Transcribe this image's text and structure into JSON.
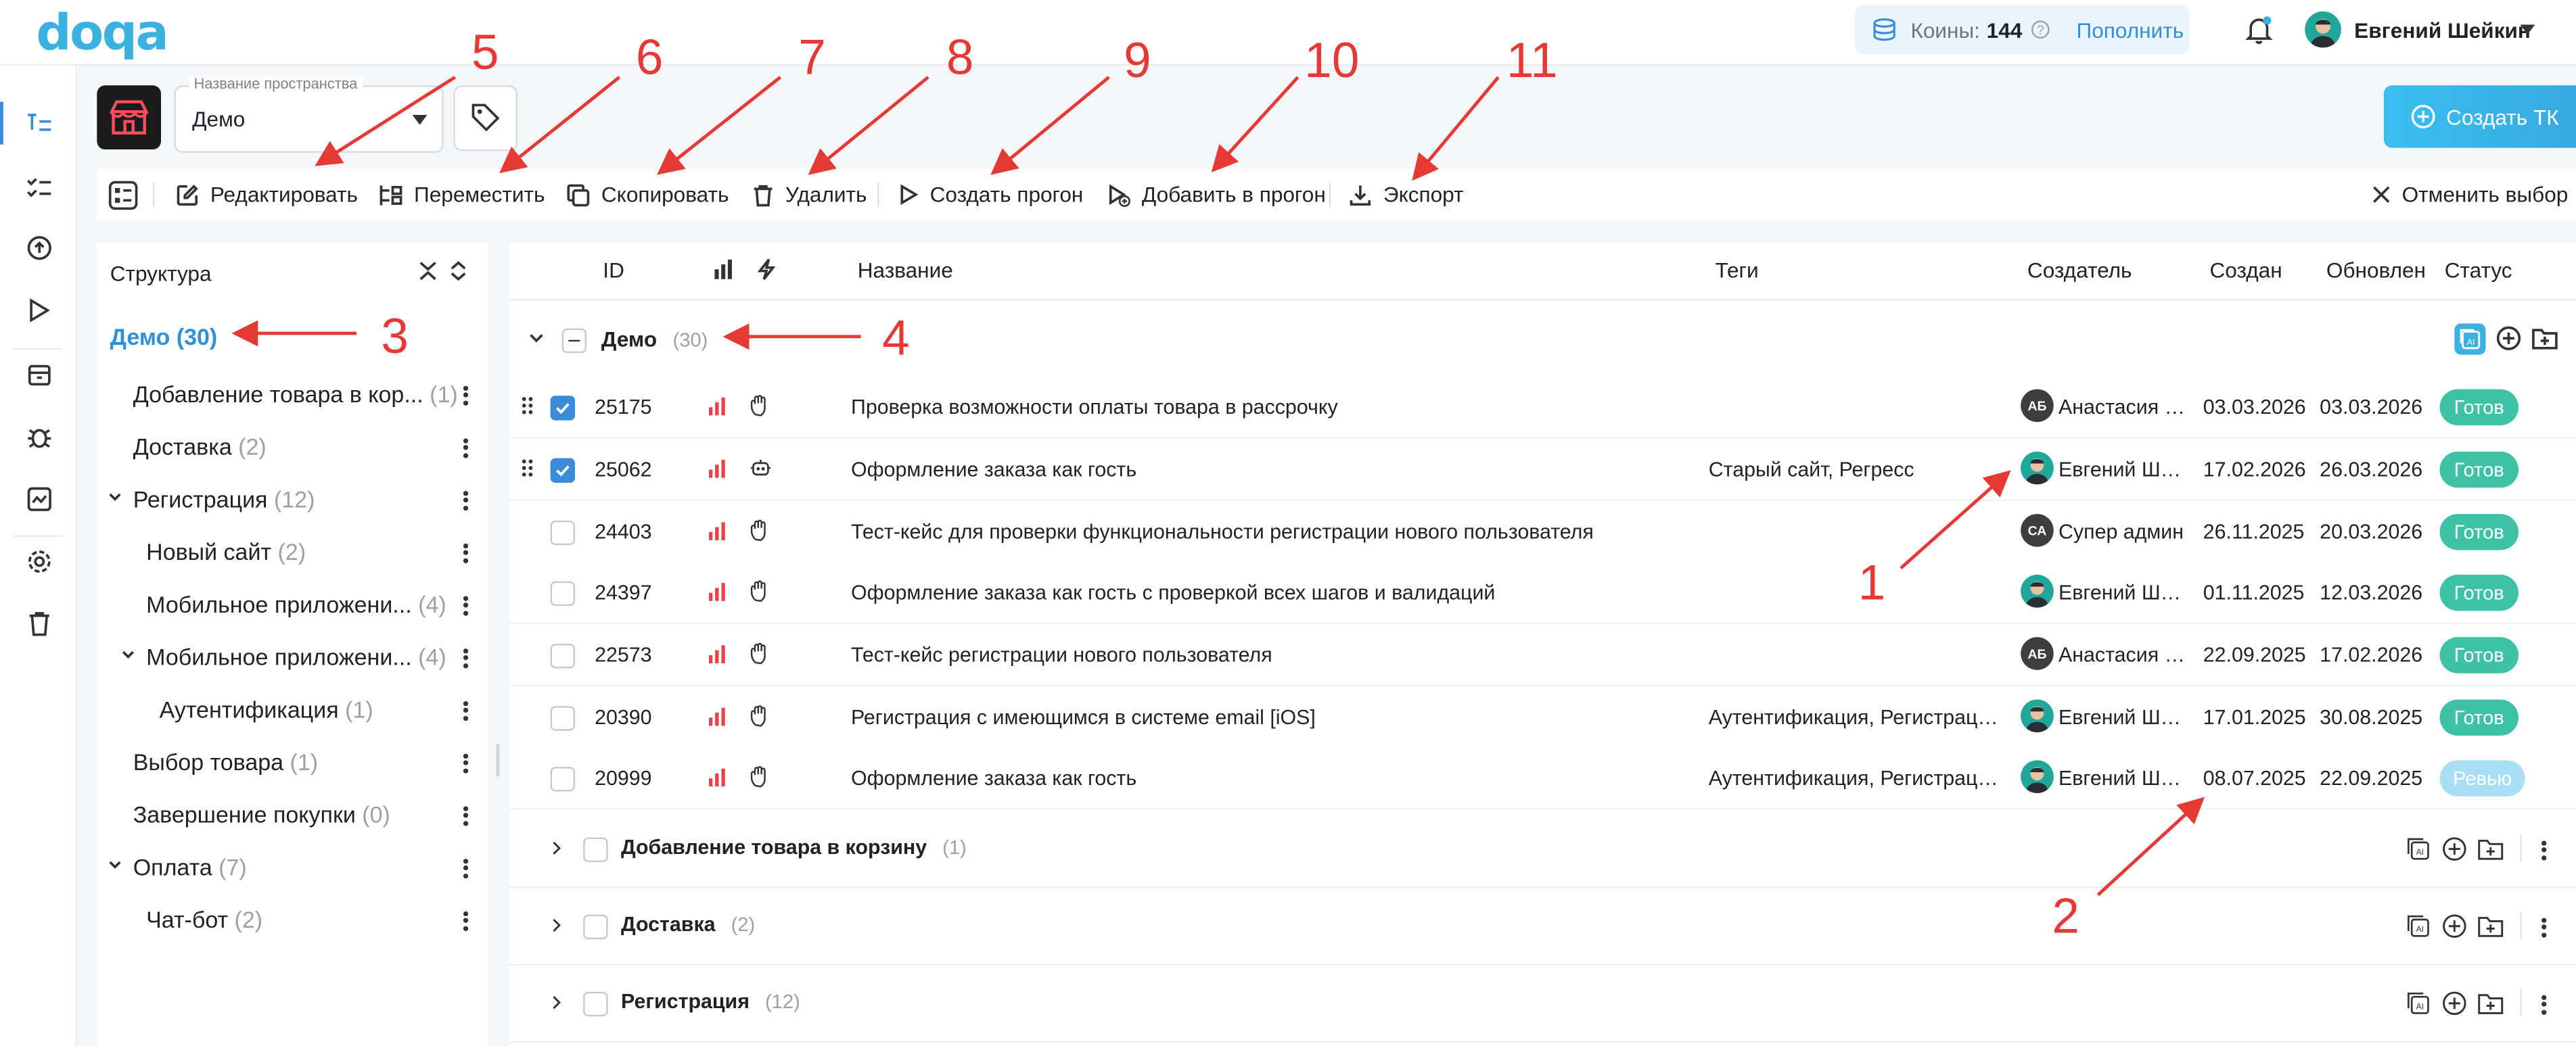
{
  "app": {
    "logo": "doqa"
  },
  "header": {
    "coins_label": "Коины:",
    "coins_value": "144",
    "topup_label": "Пополнить",
    "user_name": "Евгений Шейкин"
  },
  "workspace": {
    "field_label": "Название пространства",
    "value": "Демо",
    "create_button": "Создать ТК"
  },
  "actions": {
    "edit": "Редактировать",
    "move": "Переместить",
    "copy": "Скопировать",
    "delete": "Удалить",
    "create_run": "Создать прогон",
    "add_to_run": "Добавить в прогон",
    "export": "Экспорт",
    "cancel_selection": "Отменить выбор"
  },
  "structure": {
    "title": "Структура",
    "root": {
      "label": "Демо",
      "count": "(30)"
    },
    "items": [
      {
        "label": "Добавление товара в кор...",
        "count": "(1)"
      },
      {
        "label": "Доставка",
        "count": "(2)"
      },
      {
        "label": "Регистрация",
        "count": "(12)"
      },
      {
        "label": "Новый сайт",
        "count": "(2)"
      },
      {
        "label": "Мобильное приложени...",
        "count": "(4)"
      },
      {
        "label": "Мобильное приложени...",
        "count": "(4)"
      },
      {
        "label": "Аутентификация",
        "count": "(1)"
      },
      {
        "label": "Выбор товара",
        "count": "(1)"
      },
      {
        "label": "Завершение покупки",
        "count": "(0)"
      },
      {
        "label": "Оплата",
        "count": "(7)"
      },
      {
        "label": "Чат-бот",
        "count": "(2)"
      }
    ]
  },
  "table": {
    "columns": {
      "id": "ID",
      "name": "Название",
      "tags": "Теги",
      "creator": "Создатель",
      "created": "Создан",
      "updated": "Обновлен",
      "status": "Статус"
    },
    "group": {
      "label": "Демо",
      "count": "(30)"
    },
    "rows": [
      {
        "id": "25175",
        "name": "Проверка возможности оплаты товара в рассрочку",
        "tags": "",
        "avatar": "АБ",
        "creator": "Анастасия Б...",
        "created": "03.03.2026",
        "updated": "03.03.2026",
        "status": "Готов"
      },
      {
        "id": "25062",
        "name": "Оформление заказа как гость",
        "tags": "Старый сайт, Регресс",
        "avatar": "",
        "creator": "Евгений Шей...",
        "created": "17.02.2026",
        "updated": "26.03.2026",
        "status": "Готов"
      },
      {
        "id": "24403",
        "name": "Тест-кейс для проверки функциональности регистрации нового пользователя",
        "tags": "",
        "avatar": "СА",
        "creator": "Супер админ",
        "created": "26.11.2025",
        "updated": "20.03.2026",
        "status": "Готов"
      },
      {
        "id": "24397",
        "name": "Оформление заказа как гость с проверкой всех шагов и валидаций",
        "tags": "",
        "avatar": "",
        "creator": "Евгений Шей...",
        "created": "01.11.2025",
        "updated": "12.03.2026",
        "status": "Готов"
      },
      {
        "id": "22573",
        "name": "Тест-кейс регистрации нового пользователя",
        "tags": "",
        "avatar": "АБ",
        "creator": "Анастасия Б...",
        "created": "22.09.2025",
        "updated": "17.02.2026",
        "status": "Готов"
      },
      {
        "id": "20390",
        "name": "Регистрация с имеющимся в системе email [iOS]",
        "tags": "Аутентификация, Регистрация, ...",
        "avatar": "",
        "creator": "Евгений Шей...",
        "created": "17.01.2025",
        "updated": "30.08.2025",
        "status": "Готов"
      },
      {
        "id": "20999",
        "name": "Оформление заказа как гость",
        "tags": "Аутентификация, Регистрация, ...",
        "avatar": "",
        "creator": "Евгений Шей...",
        "created": "08.07.2025",
        "updated": "22.09.2025",
        "status": "Ревью"
      }
    ],
    "collapsed_groups": [
      {
        "label": "Добавление товара в корзину",
        "count": "(1)"
      },
      {
        "label": "Доставка",
        "count": "(2)"
      },
      {
        "label": "Регистрация",
        "count": "(12)"
      }
    ]
  },
  "annotations": [
    "1",
    "2",
    "3",
    "4",
    "5",
    "6",
    "7",
    "8",
    "9",
    "10",
    "11"
  ],
  "colors": {
    "accent": "#3bb1e0",
    "ready": "#3fc1a5",
    "review": "#a9dff5",
    "annotation": "#e53935",
    "priority": "#e8414a"
  }
}
